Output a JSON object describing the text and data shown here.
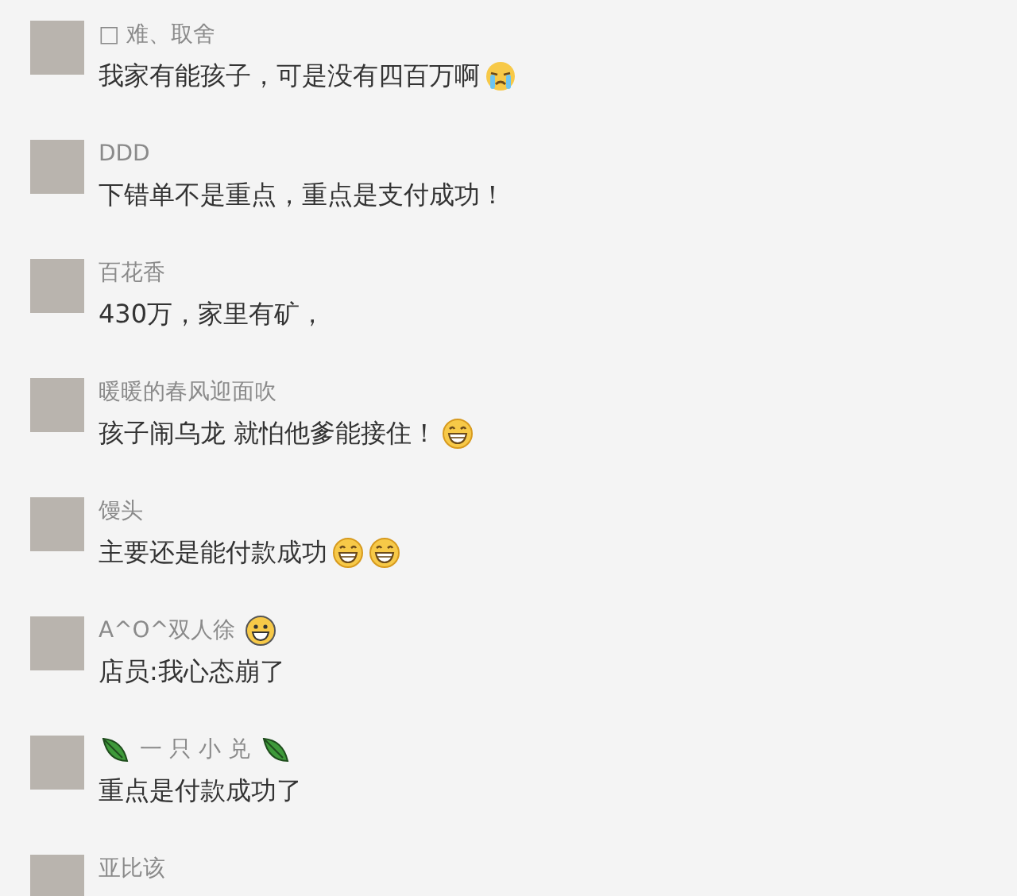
{
  "comments": [
    {
      "name": "□ 难、取舍",
      "message": "我家有能孩子，可是没有四百万啊",
      "message_icons": [
        {
          "kind": "crying"
        }
      ]
    },
    {
      "name": "DDD",
      "message": "下错单不是重点，重点是支付成功！"
    },
    {
      "name": "百花香",
      "message": "430万，家里有矿，"
    },
    {
      "name": "暖暖的春风迎面吹",
      "message": "孩子闹乌龙 就怕他爹能接住！",
      "message_icons": [
        {
          "kind": "grin"
        }
      ]
    },
    {
      "name": "馒头",
      "message": "主要还是能付款成功",
      "message_icons": [
        {
          "kind": "grin"
        },
        {
          "kind": "grin"
        }
      ]
    },
    {
      "name": "A^O^双人徐",
      "name_icons_after": [
        {
          "kind": "smile"
        }
      ],
      "message": "店员:我心态崩了"
    },
    {
      "name": "一 只 小 兑",
      "name_icons_before": [
        {
          "kind": "leaf"
        }
      ],
      "name_icons_after": [
        {
          "kind": "leaf"
        }
      ],
      "message": "重点是付款成功了"
    },
    {
      "name": "亚比该"
    }
  ]
}
